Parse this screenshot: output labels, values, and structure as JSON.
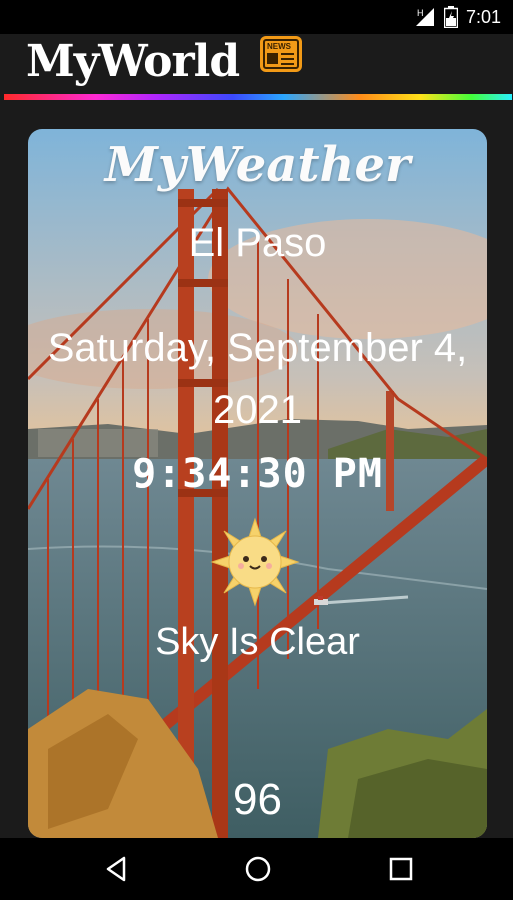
{
  "status_bar": {
    "time": "7:01",
    "network_label": "H"
  },
  "app": {
    "title": "MyWorld",
    "news_icon_label": "NEWS"
  },
  "weather": {
    "title": "MyWeather",
    "city": "El Paso",
    "date": "Saturday, September 4, 2021",
    "time": "9:34:30 PM",
    "condition": "Sky Is Clear",
    "temperature": "96",
    "icon": "sun-icon"
  },
  "navigation": {
    "icons": [
      "back-icon",
      "home-icon",
      "recents-icon"
    ]
  },
  "colors": {
    "accent": "#f29a17",
    "background": "#1b1b1b"
  }
}
